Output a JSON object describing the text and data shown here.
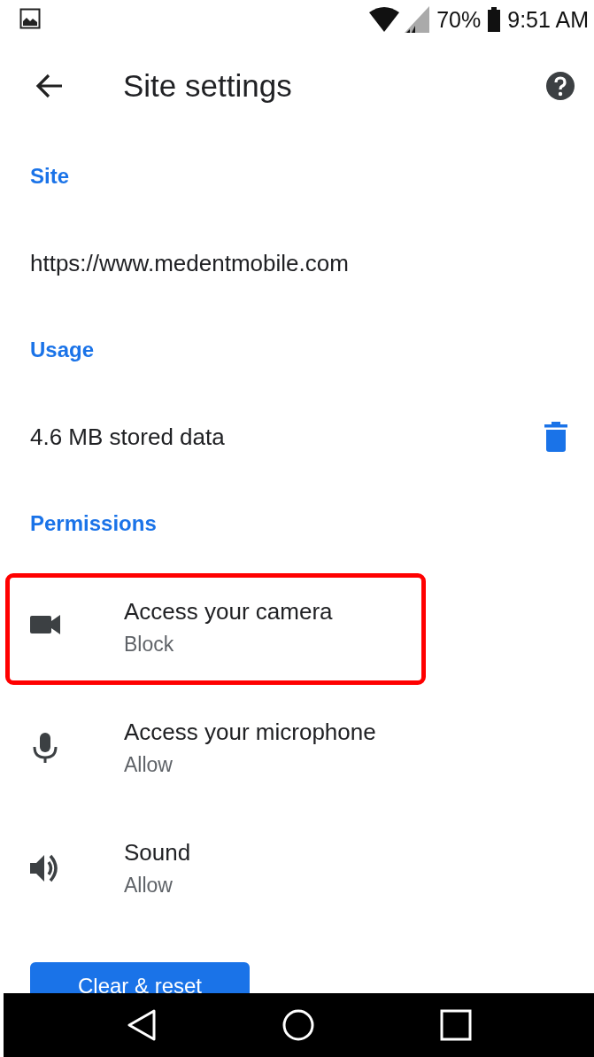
{
  "status_bar": {
    "battery": "70%",
    "time": "9:51 AM"
  },
  "toolbar": {
    "title": "Site settings"
  },
  "items": [
    {
      "kind": "header",
      "text": "Site"
    },
    {
      "kind": "text",
      "text": "https://www.medentmobile.com"
    },
    {
      "kind": "header",
      "text": "Usage"
    },
    {
      "kind": "storage",
      "text": "4.6 MB stored data"
    },
    {
      "kind": "header",
      "text": "Permissions"
    },
    {
      "kind": "permission",
      "title": "Access your camera",
      "value": "Block",
      "highlighted": true
    },
    {
      "kind": "permission",
      "title": "Access your microphone",
      "value": "Allow",
      "highlighted": false
    },
    {
      "kind": "permission",
      "title": "Sound",
      "value": "Allow",
      "highlighted": false
    }
  ],
  "button": {
    "label": "Clear & reset"
  }
}
